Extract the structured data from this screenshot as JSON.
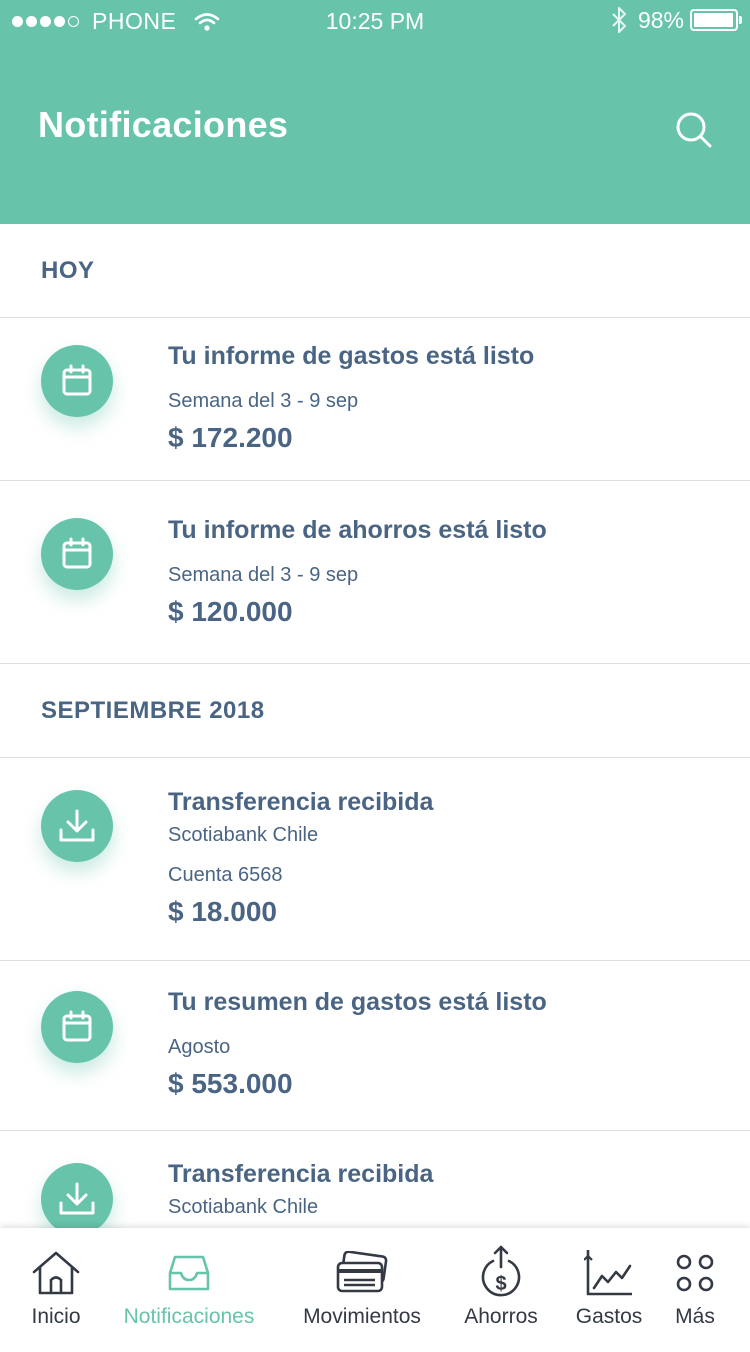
{
  "status_bar": {
    "carrier": "PHONE",
    "time": "10:25 PM",
    "battery": "98%",
    "battery_level": 0.98
  },
  "header": {
    "title": "Notificaciones",
    "search_icon": "search-icon"
  },
  "sections": [
    {
      "label": "HOY",
      "items": [
        {
          "icon": "calendar-icon",
          "title": "Tu informe de gastos está listo",
          "lines": [
            "Semana del 3 - 9 sep"
          ],
          "amount": "$ 172.200"
        },
        {
          "icon": "calendar-icon",
          "title": "Tu informe de ahorros está listo",
          "lines": [
            "Semana del 3 - 9 sep"
          ],
          "amount": "$ 120.000"
        }
      ]
    },
    {
      "label": "SEPTIEMBRE 2018",
      "items": [
        {
          "icon": "download-icon",
          "title": "Transferencia recibida",
          "lines": [
            "Scotiabank Chile",
            "Cuenta 6568"
          ],
          "amount": "$ 18.000"
        },
        {
          "icon": "calendar-icon",
          "title": "Tu resumen de gastos está listo",
          "lines": [
            "Agosto"
          ],
          "amount": "$ 553.000"
        },
        {
          "icon": "download-icon",
          "title": "Transferencia recibida",
          "lines": [
            "Scotiabank Chile"
          ]
        }
      ]
    }
  ],
  "tabbar": {
    "active": "Notificaciones",
    "tabs": [
      {
        "label": "Inicio",
        "icon": "home-icon"
      },
      {
        "label": "Notificaciones",
        "icon": "inbox-icon"
      },
      {
        "label": "Movimientos",
        "icon": "cards-icon"
      },
      {
        "label": "Ahorros",
        "icon": "savings-icon"
      },
      {
        "label": "Gastos",
        "icon": "chart-icon"
      },
      {
        "label": "Más",
        "icon": "more-icon"
      }
    ]
  },
  "colors": {
    "accent": "#67c4ab",
    "text": "#4a6584",
    "tab_text": "#333a44"
  }
}
